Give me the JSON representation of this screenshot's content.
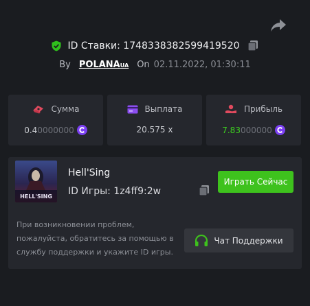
{
  "header": {
    "bet_id_label": "ID Ставки: 1748338382599419520",
    "by_label": "By",
    "username": "POLANA",
    "username_suffix": "UA",
    "on_label": "On",
    "date": "02.11.2022, 01:30:11"
  },
  "stats": {
    "amount": {
      "label": "Сумма",
      "value_main": "0.4",
      "value_dim": "0000000"
    },
    "payout": {
      "label": "Выплата",
      "value": "20.575 x"
    },
    "profit": {
      "label": "Прибыль",
      "value_main": "7.83",
      "value_dim": "000000"
    }
  },
  "game": {
    "thumb_text": "HELL'SING",
    "name": "Hell'Sing",
    "id_label": "ID Игры: 1z4ff9:2w",
    "play_label": "Играть Сейчас",
    "help_text": "При возникновении проблем, пожалуйста, обратитесь за помощью в службу поддержки и укажите ID игры.",
    "support_label": "Чат Поддержки"
  },
  "icons": {
    "share": "share-icon",
    "verified": "shield-check-icon",
    "copy": "copy-icon",
    "amount": "money-icon",
    "payout": "card-icon",
    "profit": "profit-icon",
    "coin": "coin-icon",
    "support": "headset-icon"
  },
  "colors": {
    "background": "#1a1c20",
    "card": "#25272d",
    "accent_green": "#3ec21d",
    "profit_green": "#3dd11f",
    "coin_purple": "#7b3ff2"
  }
}
